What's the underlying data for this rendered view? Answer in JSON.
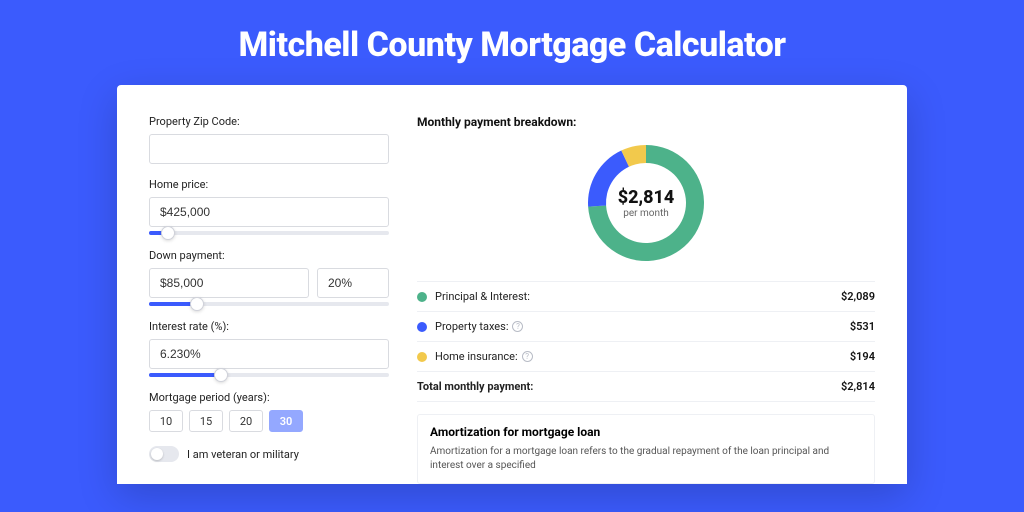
{
  "title": "Mitchell County Mortgage Calculator",
  "form": {
    "zip_label": "Property Zip Code:",
    "zip_value": "",
    "home_price_label": "Home price:",
    "home_price_value": "$425,000",
    "home_price_pct": 8,
    "down_payment_label": "Down payment:",
    "down_payment_value": "$85,000",
    "down_payment_pct_value": "20%",
    "down_payment_slider_pct": 20,
    "interest_label": "Interest rate (%):",
    "interest_value": "6.230%",
    "interest_slider_pct": 30,
    "period_label": "Mortgage period (years):",
    "periods": [
      "10",
      "15",
      "20",
      "30"
    ],
    "period_active": "30",
    "veteran_label": "I am veteran or military",
    "veteran_on": false
  },
  "breakdown": {
    "title": "Monthly payment breakdown:",
    "center_amount": "$2,814",
    "center_label": "per month",
    "items": [
      {
        "label": "Principal & Interest:",
        "value": "$2,089",
        "color": "#4db28a",
        "info": false,
        "pct": 74
      },
      {
        "label": "Property taxes:",
        "value": "$531",
        "color": "#3b5bfd",
        "info": true,
        "pct": 19
      },
      {
        "label": "Home insurance:",
        "value": "$194",
        "color": "#f2c94c",
        "info": true,
        "pct": 7
      }
    ],
    "total_label": "Total monthly payment:",
    "total_value": "$2,814"
  },
  "amortization": {
    "title": "Amortization for mortgage loan",
    "text": "Amortization for a mortgage loan refers to the gradual repayment of the loan principal and interest over a specified"
  },
  "chart_data": {
    "type": "pie",
    "title": "Monthly payment breakdown",
    "categories": [
      "Principal & Interest",
      "Property taxes",
      "Home insurance"
    ],
    "values": [
      2089,
      531,
      194
    ],
    "colors": [
      "#4db28a",
      "#3b5bfd",
      "#f2c94c"
    ],
    "total": 2814,
    "unit": "USD per month"
  }
}
